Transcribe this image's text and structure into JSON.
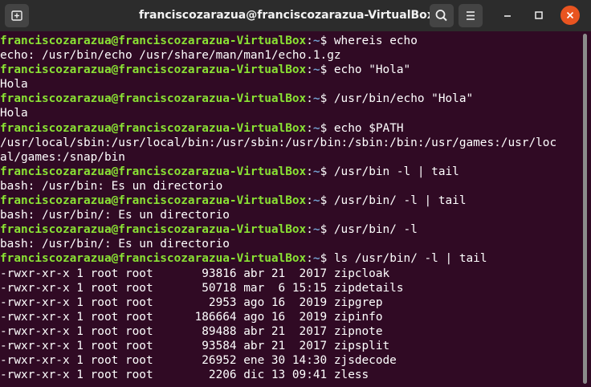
{
  "window": {
    "title": "franciscozarazua@franciscozarazua-VirtualBox: ~"
  },
  "icons": {
    "new_tab": "new-tab-icon",
    "search": "search-icon",
    "menu": "hamburger-menu-icon",
    "minimize": "minimize-icon",
    "maximize": "maximize-icon",
    "close": "close-icon"
  },
  "colors": {
    "terminal_bg": "#300a24",
    "prompt_user": "#8ae234",
    "prompt_path": "#729fcf",
    "close_button": "#e95420"
  },
  "prompt": {
    "user_host": "franciscozarazua@franciscozarazua-VirtualBox",
    "sep": ":",
    "path": "~",
    "symbol": "$ "
  },
  "terminal": {
    "lines": [
      {
        "kind": "cmd",
        "text": "whereis echo"
      },
      {
        "kind": "out",
        "text": "echo: /usr/bin/echo /usr/share/man/man1/echo.1.gz"
      },
      {
        "kind": "cmd",
        "text": "echo \"Hola\""
      },
      {
        "kind": "out",
        "text": "Hola"
      },
      {
        "kind": "cmd",
        "text": "/usr/bin/echo \"Hola\""
      },
      {
        "kind": "out",
        "text": "Hola"
      },
      {
        "kind": "cmd",
        "text": "echo $PATH"
      },
      {
        "kind": "out",
        "text": "/usr/local/sbin:/usr/local/bin:/usr/sbin:/usr/bin:/sbin:/bin:/usr/games:/usr/loc"
      },
      {
        "kind": "out",
        "text": "al/games:/snap/bin"
      },
      {
        "kind": "cmd",
        "text": "/usr/bin -l | tail"
      },
      {
        "kind": "out",
        "text": "bash: /usr/bin: Es un directorio"
      },
      {
        "kind": "cmd",
        "text": "/usr/bin/ -l | tail"
      },
      {
        "kind": "out",
        "text": "bash: /usr/bin/: Es un directorio"
      },
      {
        "kind": "cmd",
        "text": "/usr/bin/ -l"
      },
      {
        "kind": "out",
        "text": "bash: /usr/bin/: Es un directorio"
      },
      {
        "kind": "cmd",
        "text": "ls /usr/bin/ -l | tail"
      },
      {
        "kind": "out",
        "text": "-rwxr-xr-x 1 root root       93816 abr 21  2017 zipcloak"
      },
      {
        "kind": "out",
        "text": "-rwxr-xr-x 1 root root       50718 mar  6 15:15 zipdetails"
      },
      {
        "kind": "out",
        "text": "-rwxr-xr-x 1 root root        2953 ago 16  2019 zipgrep"
      },
      {
        "kind": "out",
        "text": "-rwxr-xr-x 1 root root      186664 ago 16  2019 zipinfo"
      },
      {
        "kind": "out",
        "text": "-rwxr-xr-x 1 root root       89488 abr 21  2017 zipnote"
      },
      {
        "kind": "out",
        "text": "-rwxr-xr-x 1 root root       93584 abr 21  2017 zipsplit"
      },
      {
        "kind": "out",
        "text": "-rwxr-xr-x 1 root root       26952 ene 30 14:30 zjsdecode"
      },
      {
        "kind": "out",
        "text": "-rwxr-xr-x 1 root root        2206 dic 13 09:41 zless"
      }
    ]
  }
}
